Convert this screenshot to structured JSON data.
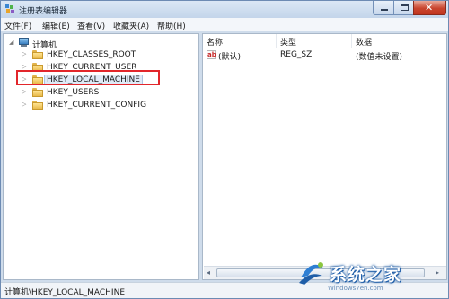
{
  "window": {
    "title": "注册表编辑器"
  },
  "menu": [
    "文件(F)",
    "编辑(E)",
    "查看(V)",
    "收藏夹(A)",
    "帮助(H)"
  ],
  "tree": {
    "root": "计算机",
    "keys": [
      "HKEY_CLASSES_ROOT",
      "HKEY_CURRENT_USER",
      "HKEY_LOCAL_MACHINE",
      "HKEY_USERS",
      "HKEY_CURRENT_CONFIG"
    ],
    "selected_index": 2
  },
  "list": {
    "columns": [
      "名称",
      "类型",
      "数据"
    ],
    "rows": [
      {
        "name": "(默认)",
        "type": "REG_SZ",
        "data": "(数值未设置)",
        "icon": "ab-string-icon"
      }
    ]
  },
  "status": {
    "path": "计算机\\HKEY_LOCAL_MACHINE"
  },
  "watermark": {
    "text": "系统之家",
    "sub": "Windows7en.com"
  },
  "colors": {
    "highlight": "#e2262b",
    "selection": "#dfeaf7",
    "close_button": "#c9452e"
  }
}
